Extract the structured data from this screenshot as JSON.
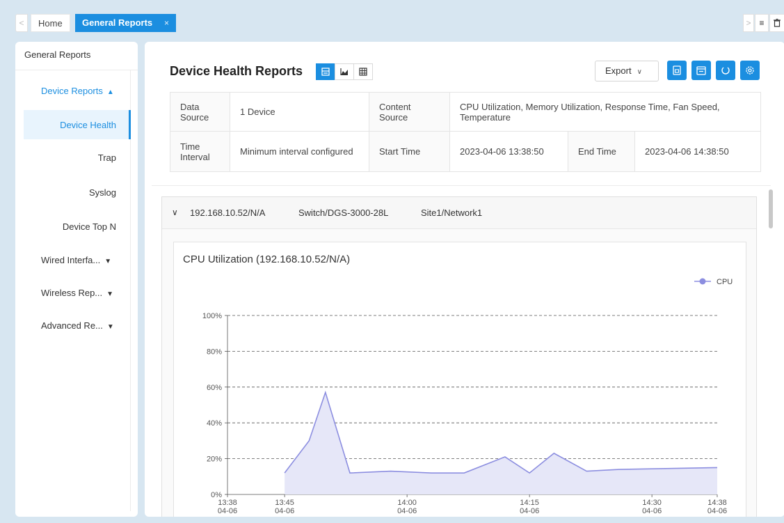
{
  "tabs": {
    "prev": "<",
    "home": "Home",
    "active": "General Reports",
    "close": "×",
    "next": ">",
    "menu": "≡",
    "trash": "🗑"
  },
  "sidebar": {
    "title": "General Reports",
    "device_reports": "Device Reports",
    "items": [
      "Device Health",
      "Trap",
      "Syslog",
      "Device Top N"
    ],
    "wired": "Wired Interfa...",
    "wireless": "Wireless Rep...",
    "advanced": "Advanced Re..."
  },
  "header": {
    "title": "Device Health Reports",
    "export": "Export"
  },
  "info": {
    "data_source_label": "Data Source",
    "data_source": "1 Device",
    "content_source_label": "Content Source",
    "content_source": "CPU Utilization, Memory Utilization, Response Time, Fan Speed, Temperature",
    "time_interval_label": "Time Interval",
    "time_interval": "Minimum interval configured",
    "start_label": "Start Time",
    "start": "2023-04-06 13:38:50",
    "end_label": "End Time",
    "end": "2023-04-06 14:38:50"
  },
  "device": {
    "chevron": "∨",
    "address": "192.168.10.52/N/A",
    "model": "Switch/DGS-3000-28L",
    "site": "Site1/Network1"
  },
  "colors": {
    "accent": "#1b8ee0",
    "series": "#8c8ee0",
    "fill": "#e6e7f8"
  },
  "chart_data": {
    "type": "area",
    "title": "CPU Utilization (192.168.10.52/N/A)",
    "series": [
      {
        "name": "CPU",
        "x": [
          "13:45",
          "13:48",
          "13:50",
          "13:53",
          "13:58",
          "14:03",
          "14:07",
          "14:12",
          "14:15",
          "14:18",
          "14:22",
          "14:26",
          "14:38"
        ],
        "values": [
          12,
          30,
          57,
          12,
          13,
          12,
          12,
          21,
          12,
          23,
          13,
          14,
          15
        ]
      }
    ],
    "yticks": [
      "100%",
      "80%",
      "60%",
      "40%",
      "20%",
      "0%"
    ],
    "ylim": [
      0,
      100
    ],
    "xticks": [
      {
        "time": "13:38",
        "date": "04-06"
      },
      {
        "time": "13:45",
        "date": "04-06"
      },
      {
        "time": "14:00",
        "date": "04-06"
      },
      {
        "time": "14:15",
        "date": "04-06"
      },
      {
        "time": "14:30",
        "date": "04-06"
      },
      {
        "time": "14:38",
        "date": "04-06"
      }
    ],
    "xlim": [
      "13:38",
      "14:38"
    ],
    "grid": "horizontal dashed",
    "legend": "top-right"
  }
}
